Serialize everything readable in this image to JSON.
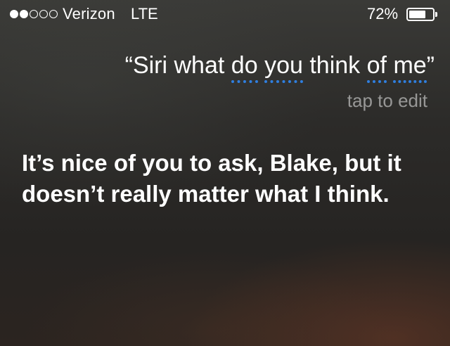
{
  "status_bar": {
    "signal_strength": 2,
    "signal_max": 5,
    "carrier": "Verizon",
    "network": "LTE",
    "battery_percent_label": "72%",
    "battery_level": 0.72
  },
  "query": {
    "open_quote": "“",
    "word_siri": "Siri",
    "word_what": "what",
    "word_do": "do",
    "word_you": "you",
    "word_think": "think",
    "word_of": "of",
    "word_me": "me",
    "close_quote": "”",
    "underline_color": "#2f7fe0"
  },
  "edit_hint": "tap to edit",
  "response": "It’s nice of you to ask, Blake, but it doesn’t really matter what I think."
}
